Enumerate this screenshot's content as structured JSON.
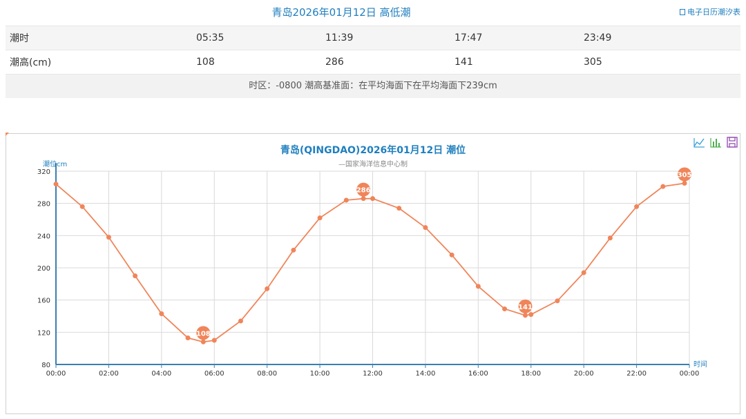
{
  "header": {
    "title": "青岛2026年01月12日 高低潮",
    "ecalendar_label": "电子日历潮汐表"
  },
  "tide_table": {
    "rows": [
      {
        "label": "潮时",
        "values": [
          "05:35",
          "11:39",
          "17:47",
          "23:49"
        ]
      },
      {
        "label": "潮高(cm)",
        "values": [
          "108",
          "286",
          "141",
          "305"
        ]
      }
    ],
    "note": "时区：-0800 潮高基准面：在平均海面下在平均海面下239cm"
  },
  "toolbox": [
    "line-chart-icon",
    "bar-chart-icon",
    "save-icon"
  ],
  "colors": {
    "series": "#f0855a",
    "title": "#1f7fbf",
    "axis": "#3a7fb0",
    "grid": "#d9d9d9"
  },
  "chart_data": {
    "type": "line",
    "title": "青岛(QINGDAO)2026年01月12日 潮位",
    "subtitle": "—国家海洋信息中心制",
    "ylabel": "潮位cm",
    "xlabel": "时间",
    "ylim": [
      80,
      320
    ],
    "y_ticks": [
      "80",
      "120",
      "160",
      "200",
      "240",
      "280",
      "320"
    ],
    "x_ticks": [
      "00:00",
      "02:00",
      "04:00",
      "06:00",
      "08:00",
      "10:00",
      "12:00",
      "14:00",
      "16:00",
      "18:00",
      "20:00",
      "22:00",
      "00:00"
    ],
    "x_range_hours": [
      0,
      24
    ],
    "grid": true,
    "series": [
      {
        "hours": [
          0,
          1,
          2,
          3,
          4,
          5,
          5.583,
          6,
          7,
          8,
          9,
          10,
          11,
          11.65,
          12,
          13,
          14,
          15,
          16,
          17,
          17.783,
          18,
          19,
          20,
          21,
          22,
          23,
          23.817
        ],
        "values": [
          304,
          276,
          238,
          190,
          143,
          113,
          108,
          110,
          134,
          174,
          222,
          262,
          284,
          286,
          286,
          274,
          250,
          216,
          177,
          149,
          141,
          142,
          159,
          194,
          237,
          276,
          301,
          305
        ]
      }
    ],
    "markers": [
      {
        "hour": 5.583,
        "value": 108,
        "label": "108"
      },
      {
        "hour": 11.65,
        "value": 286,
        "label": "286"
      },
      {
        "hour": 17.783,
        "value": 141,
        "label": "141"
      },
      {
        "hour": 23.817,
        "value": 305,
        "label": "305"
      }
    ]
  }
}
